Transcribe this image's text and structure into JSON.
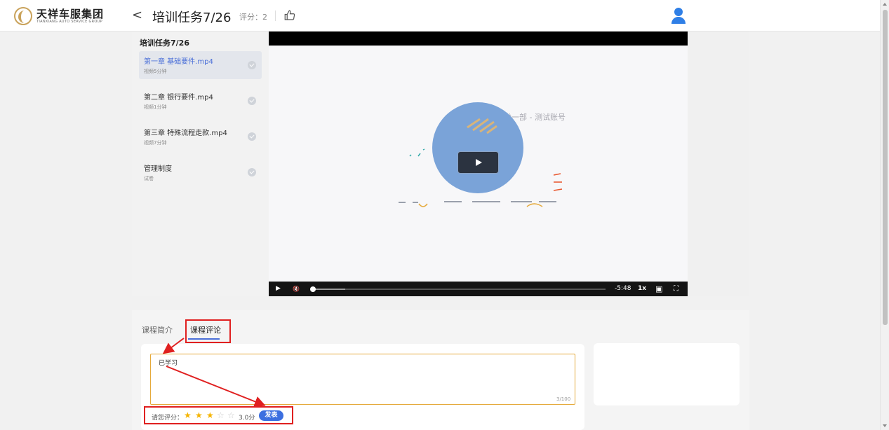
{
  "header": {
    "logo_cn": "天祥车服集团",
    "logo_en": "TIANXIANG AUTO SERVICE GROUP",
    "back_icon": "chevron-left-icon",
    "back_glyph": "<",
    "title": "培训任务7/26",
    "score": "评分：2",
    "like_icon": "thumbs-up-icon",
    "avatar_icon": "user-avatar-icon"
  },
  "sidebar": {
    "title": "培训任务7/26",
    "items": [
      {
        "name": "第一章 基础要件.mp4",
        "sub": "视频5分钟",
        "active": true
      },
      {
        "name": "第二章 银行要件.mp4",
        "sub": "视频1分钟",
        "active": false
      },
      {
        "name": "第三章 特殊流程走款.mp4",
        "sub": "视频7分钟",
        "active": false
      },
      {
        "name": "管理制度",
        "sub": "试卷",
        "active": false
      }
    ]
  },
  "video": {
    "watermark": "发一部 - 测试账号",
    "time_remaining": "-5:48",
    "speed": "1x",
    "progress": 0.11,
    "play_glyph": "▶",
    "mute_glyph": "🔇",
    "pip_glyph": "▣",
    "fullscreen_glyph": "⛶"
  },
  "tabs": {
    "intro": "课程简介",
    "comments": "课程评论"
  },
  "comment": {
    "value": "已学习",
    "char_count": "3/100",
    "rating_label": "请您评分：",
    "rating_value": "3.0分",
    "stars_filled": 3,
    "stars_total": 5,
    "star_glyph_on": "★",
    "star_glyph_off": "☆",
    "submit_label": "发表"
  },
  "colors": {
    "accent": "#3c6fe0",
    "annotation": "#e02020",
    "star": "#f5b400",
    "input_border": "#e5a93a"
  }
}
